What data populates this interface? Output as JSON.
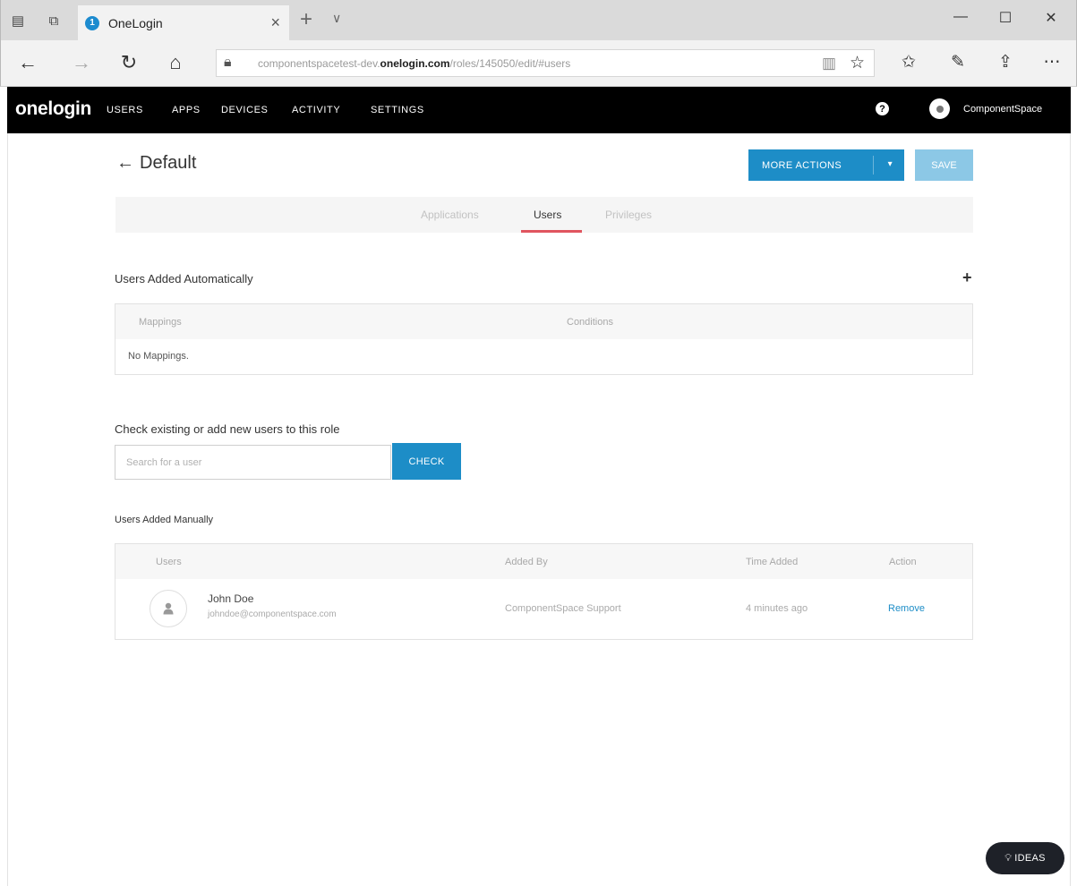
{
  "browser": {
    "tab_title": "OneLogin",
    "tab_favicon_text": "1",
    "url_prefix": "componentspacetest-dev.",
    "url_domain": "onelogin.com",
    "url_path": "/roles/145050/edit/#users",
    "tab_close": "×",
    "new_tab": "+",
    "tab_dropdown": "∨"
  },
  "app_nav": {
    "logo": "onelogin",
    "items": [
      "USERS",
      "APPS",
      "DEVICES",
      "ACTIVITY",
      "SETTINGS"
    ],
    "help": "?",
    "username": "ComponentSpace"
  },
  "page": {
    "back_arrow": "←",
    "title": "Default",
    "more_actions_label": "MORE ACTIONS",
    "more_actions_caret": "▾",
    "save_label": "SAVE",
    "tabs": [
      {
        "label": "Applications",
        "active": false
      },
      {
        "label": "Users",
        "active": true
      },
      {
        "label": "Privileges",
        "active": false
      }
    ]
  },
  "auto_section": {
    "title": "Users Added Automatically",
    "add": "+",
    "columns": [
      "Mappings",
      "Conditions"
    ],
    "empty_text": "No Mappings."
  },
  "check_section": {
    "title": "Check existing or add new users to this role",
    "search_placeholder": "Search for a user",
    "check_label": "CHECK"
  },
  "manual_section": {
    "title": "Users Added Manually",
    "columns": [
      "Users",
      "Added By",
      "Time Added",
      "Action"
    ],
    "rows": [
      {
        "name": "John Doe",
        "email": "johndoe@componentspace.com",
        "added_by": "ComponentSpace Support",
        "time_added": "4 minutes ago",
        "action": "Remove"
      }
    ]
  },
  "ideas_button": {
    "label": "IDEAS",
    "icon": "lightbulb-icon"
  },
  "colors": {
    "brand_blue": "#1d8dc7",
    "save_disabled": "#8cc8e6",
    "active_tab_underline": "#e0555f",
    "nav_bg": "#000000"
  }
}
